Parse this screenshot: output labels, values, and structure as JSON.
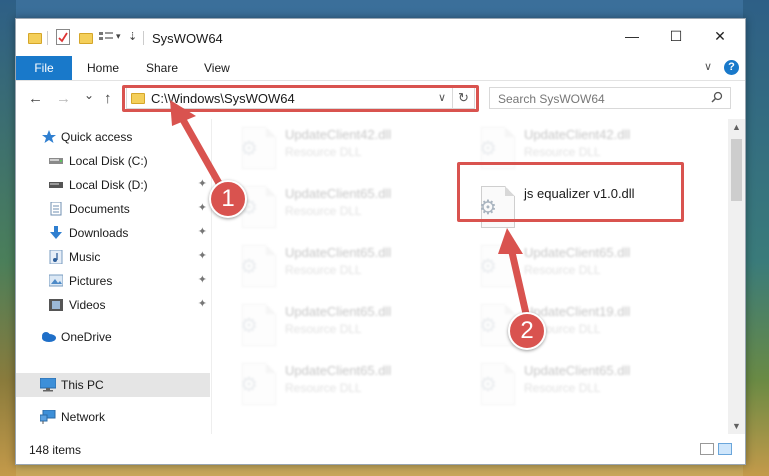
{
  "window": {
    "title": "SysWOW64",
    "controls": {
      "minimize": "—",
      "maximize": "☐",
      "close": "✕"
    },
    "help_label": "?"
  },
  "ribbon": {
    "tabs": [
      "File",
      "Home",
      "Share",
      "View"
    ],
    "collapse": "∨"
  },
  "navigation": {
    "back": "←",
    "forward": "→",
    "recent": "⌄",
    "up": "↑",
    "address": "C:\\Windows\\SysWOW64",
    "refresh": "↻",
    "search_placeholder": "Search SysWOW64",
    "search_icon": "⌕"
  },
  "sidebar": {
    "items": [
      {
        "label": "Quick access",
        "icon": "star-icon",
        "pinned": false
      },
      {
        "label": "Local Disk (C:)",
        "icon": "drive-icon",
        "pinned": false
      },
      {
        "label": "Local Disk (D:)",
        "icon": "drive-icon",
        "pinned": true
      },
      {
        "label": "Documents",
        "icon": "documents-icon",
        "pinned": true
      },
      {
        "label": "Downloads",
        "icon": "downloads-icon",
        "pinned": true
      },
      {
        "label": "Music",
        "icon": "music-icon",
        "pinned": true
      },
      {
        "label": "Pictures",
        "icon": "pictures-icon",
        "pinned": true
      },
      {
        "label": "Videos",
        "icon": "videos-icon",
        "pinned": true
      },
      {
        "label": "OneDrive",
        "icon": "onedrive-icon",
        "pinned": false
      },
      {
        "label": "This PC",
        "icon": "pc-icon",
        "pinned": false,
        "selected": true
      },
      {
        "label": "Network",
        "icon": "network-icon",
        "pinned": false
      }
    ],
    "pin_glyph": "📌"
  },
  "files": {
    "left": [
      {
        "name": "UpdateClient42.dll",
        "type": "Resource DLL"
      },
      {
        "name": "UpdateClient65.dll",
        "type": "Resource DLL"
      },
      {
        "name": "UpdateClient65.dll",
        "type": "Resource DLL"
      },
      {
        "name": "UpdateClient65.dll",
        "type": "Resource DLL"
      },
      {
        "name": "UpdateClient65.dll",
        "type": "Resource DLL"
      }
    ],
    "right": [
      {
        "name": "UpdateClient42.dll",
        "type": "Resource DLL"
      },
      {
        "name": "js equalizer v1.0.dll",
        "type": "",
        "highlighted": true
      },
      {
        "name": "UpdateClient65.dll",
        "type": "Resource DLL"
      },
      {
        "name": "UpdateClient19.dll",
        "type": "Resource DLL"
      },
      {
        "name": "UpdateClient65.dll",
        "type": "Resource DLL"
      }
    ]
  },
  "status": {
    "item_count": "148 items"
  },
  "annotations": {
    "step1": "1",
    "step2": "2",
    "highlight_color": "#d9534f"
  },
  "colors": {
    "accent": "#1979ca",
    "folder": "#f4cf5a"
  }
}
